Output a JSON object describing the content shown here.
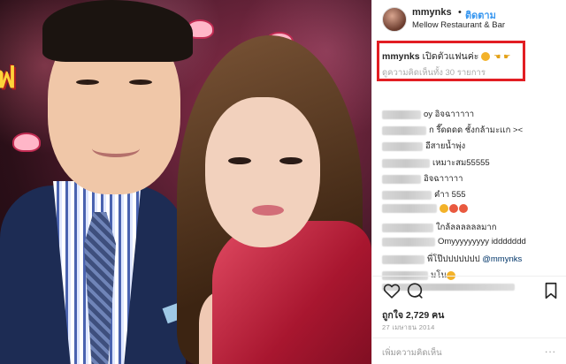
{
  "header": {
    "username": "mmynks",
    "follow_label": "ติดตาม",
    "location": "Mellow Restaurant & Bar"
  },
  "caption": {
    "username": "mmynks",
    "text": "เปิดตัวแฟนค่ะ",
    "load_more": "ดูความคิดเห็นทั้ง 30 รายการ"
  },
  "comments": [
    {
      "text": "oy อิจฉาาาาา"
    },
    {
      "text": "ก รี๊ดดดด ชั้งกล้ามะเเก ><"
    },
    {
      "text": "อีสายน้ำพุ่ง"
    },
    {
      "text": "เหมาะสม55555"
    },
    {
      "text": "อิจฉาาาาา"
    },
    {
      "text": "คำา 555"
    },
    {
      "text": ""
    },
    {
      "text": "ใกล้ลลลลลลมาก"
    },
    {
      "text": "Omyyyyyyyyy iddddddd"
    },
    {
      "text": "พี่โป๊ปปปปปปป",
      "mention": "@mmynks"
    },
    {
      "text": "มโน"
    },
    {
      "text": ""
    }
  ],
  "post": {
    "likes": "ถูกใจ 2,729 คน",
    "date": "27 เมษายน 2014",
    "add_comment_placeholder": "เพิ่มความคิดเห็น",
    "more_label": "..."
  },
  "photo": {
    "backdrop_text_1": "ฟ",
    "backdrop_text_2": "ฟ ร"
  }
}
